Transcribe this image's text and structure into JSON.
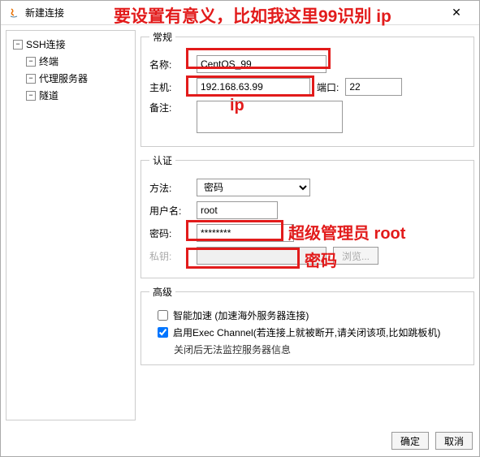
{
  "window": {
    "title": "新建连接",
    "close": "✕"
  },
  "sidebar": {
    "root": "SSH连接",
    "items": [
      "终端",
      "代理服务器",
      "隧道"
    ]
  },
  "general": {
    "legend": "常规",
    "name_label": "名称:",
    "name_value": "CentOS_99",
    "host_label": "主机:",
    "host_value": "192.168.63.99",
    "port_label": "端口:",
    "port_value": "22",
    "remark_label": "备注:",
    "remark_value": ""
  },
  "auth": {
    "legend": "认证",
    "method_label": "方法:",
    "method_value": "密码",
    "user_label": "用户名:",
    "user_value": "root",
    "pwd_label": "密码:",
    "pwd_value": "********",
    "key_label": "私钥:",
    "key_value": "",
    "browse": "浏览..."
  },
  "advanced": {
    "legend": "高级",
    "smart_accel": "智能加速 (加速海外服务器连接)",
    "exec_channel": "启用Exec Channel(若连接上就被断开,请关闭该项,比如跳板机)",
    "exec_note": "关闭后无法监控服务器信息"
  },
  "footer": {
    "ok": "确定",
    "cancel": "取消"
  },
  "annotations": {
    "top": "要设置有意义，比如我这里99识别 ip",
    "ip": "ip",
    "root": "超级管理员 root",
    "pwd": "密码"
  }
}
